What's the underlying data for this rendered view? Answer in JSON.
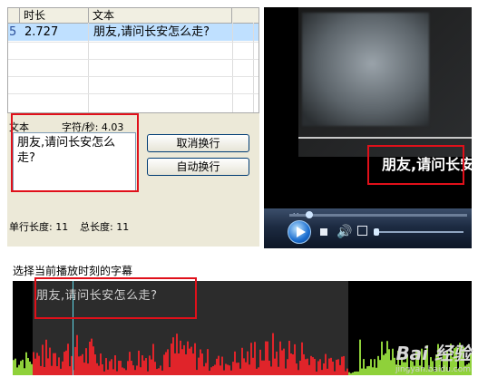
{
  "subtitle_table": {
    "headers": [
      "时长",
      "文本"
    ],
    "rows": [
      {
        "index": "5",
        "duration": "2.727",
        "text": "朋友,请问长安怎么走?",
        "selected": true
      }
    ]
  },
  "editor": {
    "text_label": "文本",
    "rate_label": "字符/秒: 4.03",
    "text_value": "朋友,请问长安怎么走?",
    "cancel_wrap_label": "取消换行",
    "auto_wrap_label": "自动换行",
    "line_length_label": "单行长度: 11",
    "total_length_label": "总长度: 11"
  },
  "player": {
    "subtitle_text": "朋友,请问长安怎么走?",
    "icons": {
      "play": "play-icon",
      "stop": "stop-icon",
      "volume": "volume-icon",
      "fullscreen": "fullscreen-icon",
      "rewind": "rewind-icon"
    }
  },
  "waveform": {
    "status_text": "选择当前播放时刻的字幕",
    "subtitle_text": "朋友,请问长安怎么走?"
  },
  "watermark": {
    "brand": "Bai 经验",
    "url": "jingyan.baidu.com"
  },
  "colors": {
    "highlight_box": "#e0101a",
    "selected_row": "#bfe0ff",
    "wave_red": "#e0242a",
    "wave_green": "#8fd13a"
  }
}
